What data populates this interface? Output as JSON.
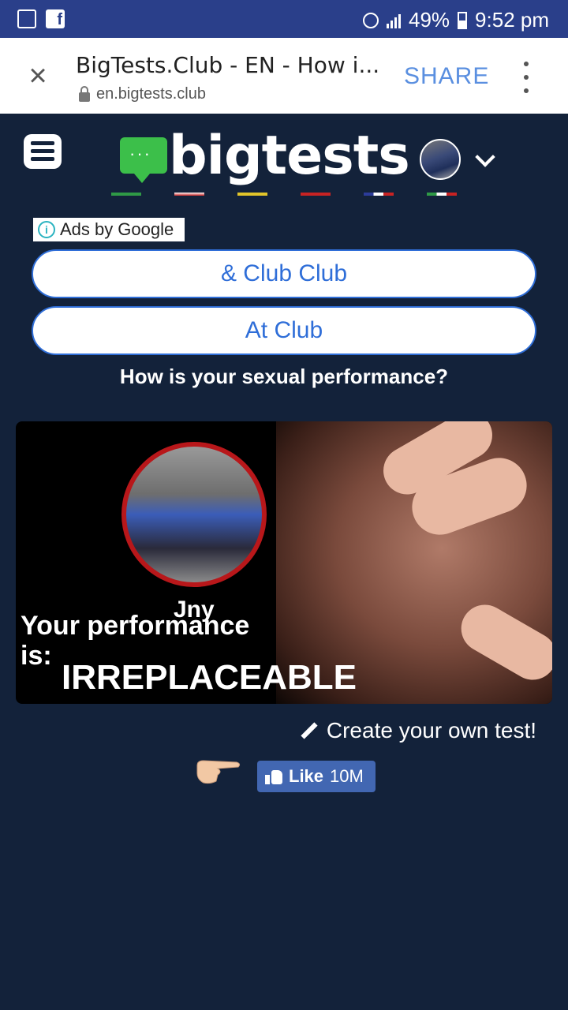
{
  "status_bar": {
    "battery": "49%",
    "time": "9:52 pm"
  },
  "browser": {
    "title": "BigTests.Club - EN - How i...",
    "url": "en.bigtests.club",
    "share_label": "SHARE"
  },
  "site": {
    "logo_text": "bigtests",
    "logo_dots": "···",
    "flag_colors": [
      "#2f9a46",
      "#c82323",
      "#e2c52a",
      "#c82323",
      "#2c3c9a",
      "#2f9a46"
    ]
  },
  "ads": {
    "label_prefix": "Ads by",
    "label_brand": "Google",
    "buttons": [
      "& Club Club",
      "At Club"
    ]
  },
  "question": "How is your sexual performance?",
  "result": {
    "name": "Jny",
    "line": "Your performance",
    "is": "is:",
    "verdict": "IRREPLACEABLE"
  },
  "actions": {
    "create_label": "Create your own test!",
    "like_label": "Like",
    "like_count": "10M"
  },
  "colors": {
    "background": "#13223a",
    "status_bar": "#2a3f8a",
    "accent_blue": "#2f6ed8",
    "facebook_blue": "#4267b2",
    "logo_green": "#3cbf4a"
  }
}
